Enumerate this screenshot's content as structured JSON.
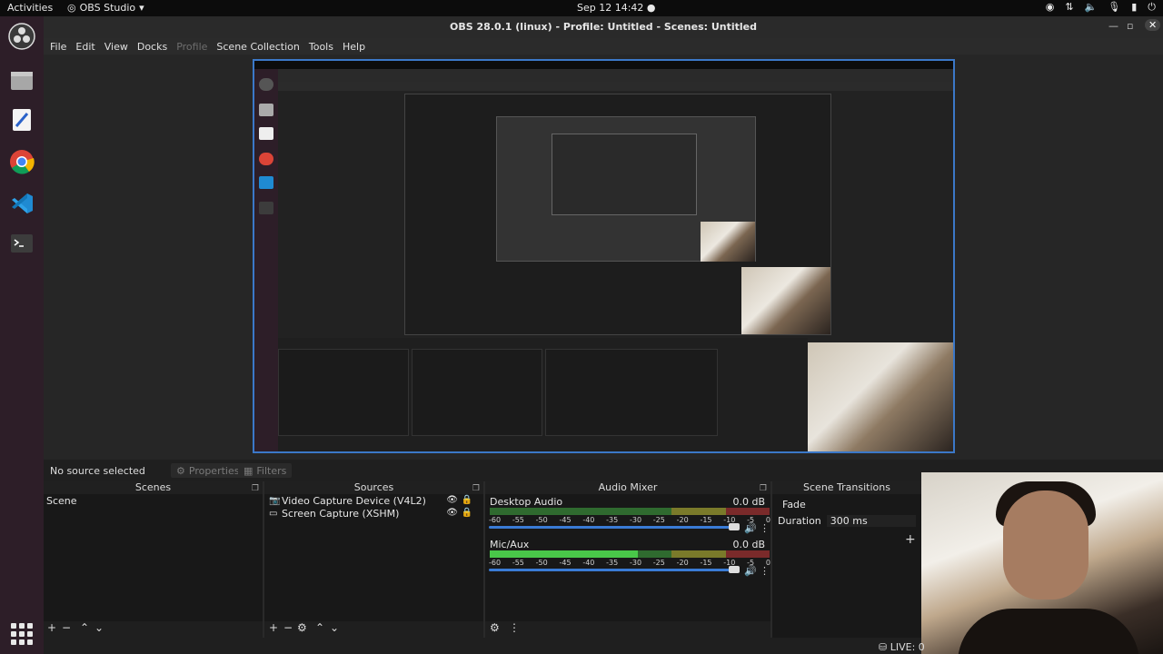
{
  "topbar": {
    "activities": "Activities",
    "app_menu": "OBS Studio",
    "clock": "Sep 12  14:42"
  },
  "window": {
    "title": "OBS 28.0.1 (linux) - Profile: Untitled - Scenes: Untitled"
  },
  "menu": {
    "file": "File",
    "edit": "Edit",
    "view": "View",
    "docks": "Docks",
    "profile": "Profile",
    "scene_collection": "Scene Collection",
    "tools": "Tools",
    "help": "Help"
  },
  "source_bar": {
    "no_source": "No source selected",
    "properties": "Properties",
    "filters": "Filters"
  },
  "scenes": {
    "header": "Scenes",
    "items": [
      "Scene"
    ]
  },
  "sources": {
    "header": "Sources",
    "items": [
      "Video Capture Device (V4L2)",
      "Screen Capture (XSHM)"
    ]
  },
  "mixer": {
    "header": "Audio Mixer",
    "channels": [
      {
        "name": "Desktop Audio",
        "db": "0.0 dB",
        "level": 0
      },
      {
        "name": "Mic/Aux",
        "db": "0.0 dB",
        "level": 0.53
      }
    ],
    "scale": [
      "-60",
      "-55",
      "-50",
      "-45",
      "-40",
      "-35",
      "-30",
      "-25",
      "-20",
      "-15",
      "-10",
      "-5",
      "0"
    ]
  },
  "transitions": {
    "header": "Scene Transitions",
    "type": "Fade",
    "duration_label": "Duration",
    "duration_value": "300 ms"
  },
  "status": {
    "live": "LIVE: 0"
  }
}
